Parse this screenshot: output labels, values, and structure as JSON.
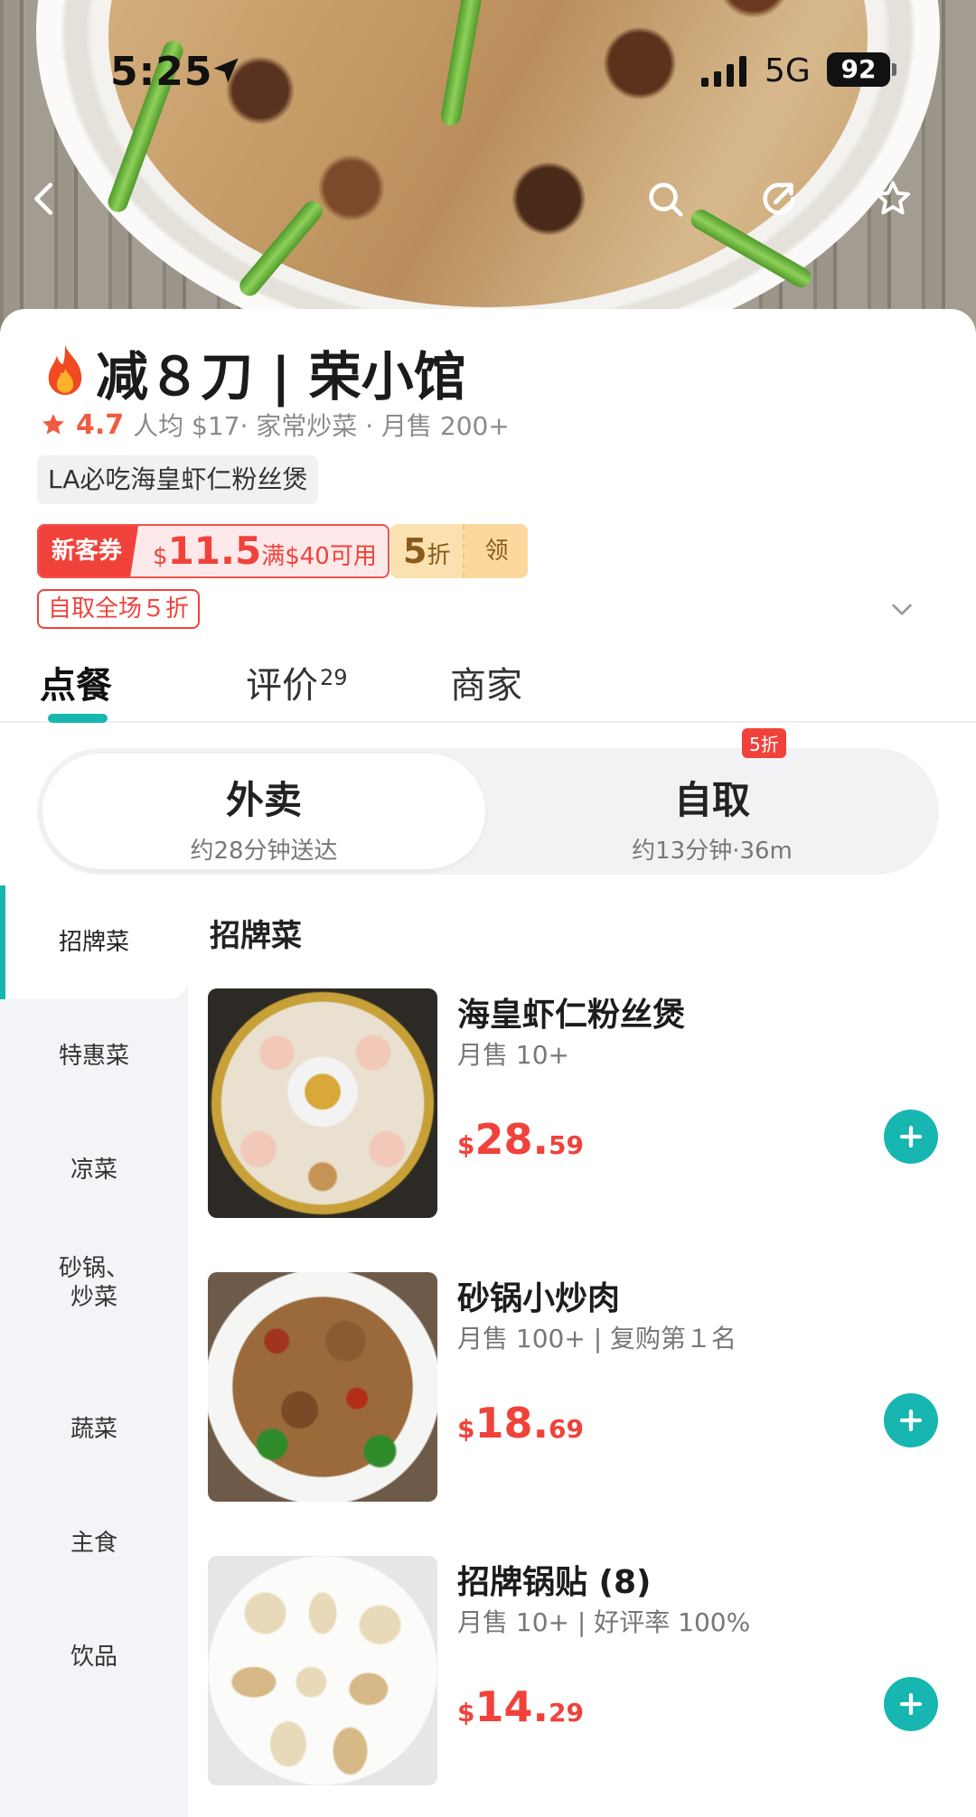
{
  "status_bar": {
    "time": "5:25",
    "network": "5G",
    "battery": "92"
  },
  "restaurant": {
    "title": "减８刀 | 荣小馆",
    "rating": "4.7",
    "meta": "人均 $17· 家常炒菜 · 月售 200+",
    "tag": "LA必吃海皇虾仁粉丝煲"
  },
  "promos": {
    "coupon_label": "新客券",
    "coupon_currency": "$",
    "coupon_amount": "11.5",
    "coupon_condition": "满$40可用",
    "discount_value": "5",
    "discount_unit": "折",
    "claim_label": "领",
    "pickup_promo": "自取全场５折"
  },
  "tabs": [
    {
      "label": "点餐"
    },
    {
      "label": "评价",
      "count": "29"
    },
    {
      "label": "商家"
    }
  ],
  "modes": {
    "delivery": {
      "title": "外卖",
      "subtitle": "约28分钟送达"
    },
    "pickup": {
      "title": "自取",
      "subtitle": "约13分钟·36m",
      "badge": "5折"
    }
  },
  "sidebar": {
    "items": [
      "招牌菜",
      "特惠菜",
      "凉菜",
      "砂锅、炒菜",
      "蔬菜",
      "主食",
      "饮品"
    ],
    "item_lines": {
      "3": [
        "砂锅、",
        "炒菜"
      ]
    }
  },
  "menu": {
    "section_title": "招牌菜",
    "dishes": [
      {
        "name": "海皇虾仁粉丝煲",
        "subtitle": "月售 10+",
        "currency": "$",
        "price_int": "28.",
        "price_dec": "59"
      },
      {
        "name": "砂锅小炒肉",
        "subtitle": "月售 100+ | 复购第１名",
        "currency": "$",
        "price_int": "18.",
        "price_dec": "69"
      },
      {
        "name": "招牌锅贴 (8)",
        "subtitle": "月售 10+ | 好评率 100%",
        "currency": "$",
        "price_int": "14.",
        "price_dec": "29"
      }
    ]
  },
  "colors": {
    "accent": "#17b6b0",
    "price": "#f0423b",
    "rating": "#f15b3f"
  }
}
